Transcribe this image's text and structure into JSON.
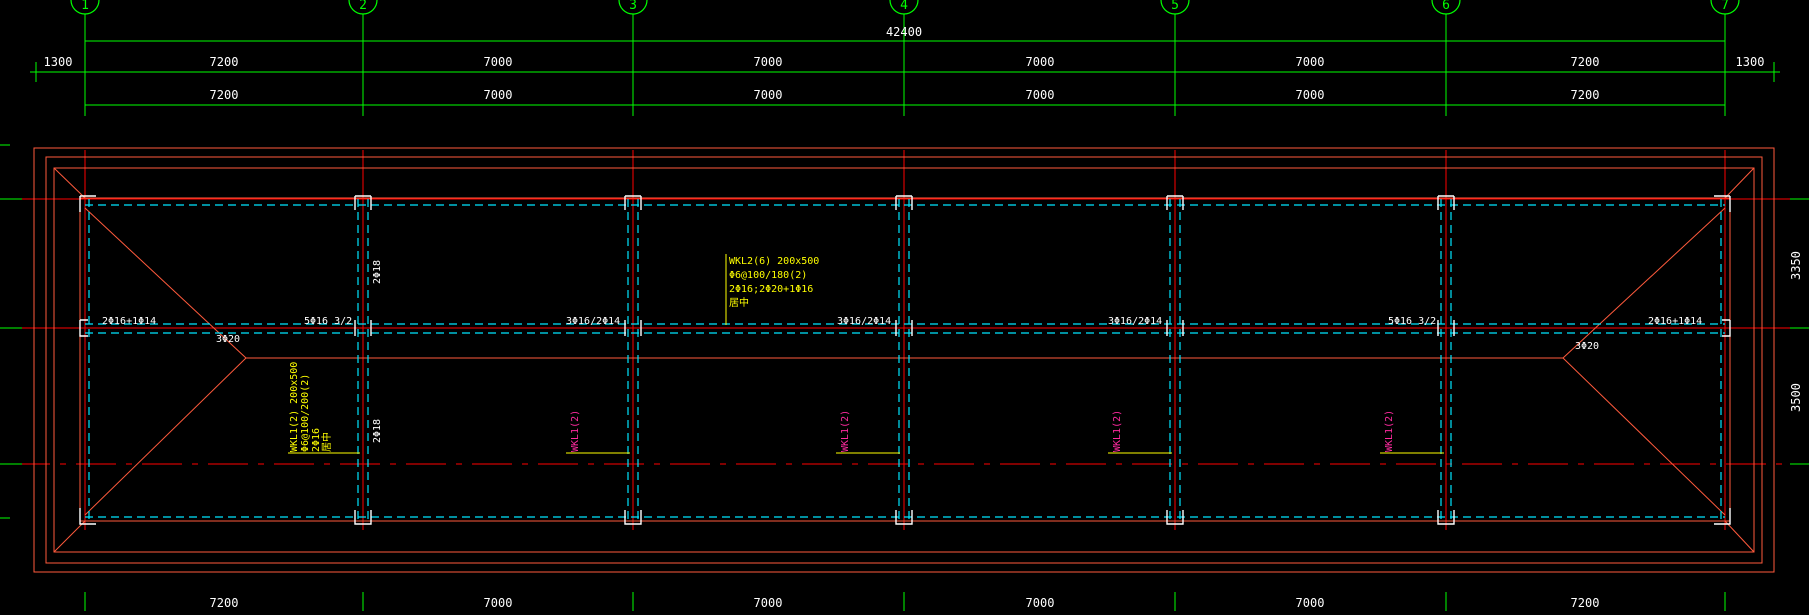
{
  "grid_axes": [
    "1",
    "2",
    "3",
    "4",
    "5",
    "6",
    "7"
  ],
  "overall_dim": "42400",
  "top_dims_row1": [
    "1300",
    "7200",
    "7000",
    "7000",
    "7000",
    "7000",
    "7200",
    "1300"
  ],
  "top_dims_row2": [
    "7200",
    "7000",
    "7000",
    "7000",
    "7000",
    "7200"
  ],
  "bottom_dims": [
    "7200",
    "7000",
    "7000",
    "7000",
    "7000",
    "7200"
  ],
  "right_dims": [
    "3350",
    "3500"
  ],
  "beam_labels": {
    "wkl2_lines": [
      "WKL2(6) 200x500",
      "Φ6@100/180(2)",
      "2Φ16;2Φ20+1Φ16",
      "居中"
    ],
    "wkl1_lines": [
      "WKL1(2) 200x500",
      "Φ6@100/200(2)",
      "2Φ16",
      "居中"
    ],
    "wkl_magenta": [
      "WKL1(2)",
      "WKL1(2)",
      "WKL1(2)",
      "WKL1(2)"
    ],
    "mid_rebar": [
      "2Φ16+1Φ14",
      "5Φ16 3/2",
      "3Φ16/2Φ14",
      "3Φ16/2Φ14",
      "3Φ16/2Φ14",
      "5Φ16 3/2",
      "2Φ16+1Φ14"
    ],
    "vert_rebar": [
      "2Φ18",
      "2Φ18"
    ],
    "hip_rebar": [
      "3Φ20",
      "3Φ20"
    ]
  },
  "colors": {
    "background": "#000000",
    "dimension": "#00ff00",
    "axis_line": "#ff0000",
    "roof_outline": "#ff5a3c",
    "hidden_beam": "#00e5ff",
    "column": "#ffffff",
    "annotation": "#ffff00",
    "magenta_label": "#ff2aa0",
    "text": "#ffffff"
  }
}
